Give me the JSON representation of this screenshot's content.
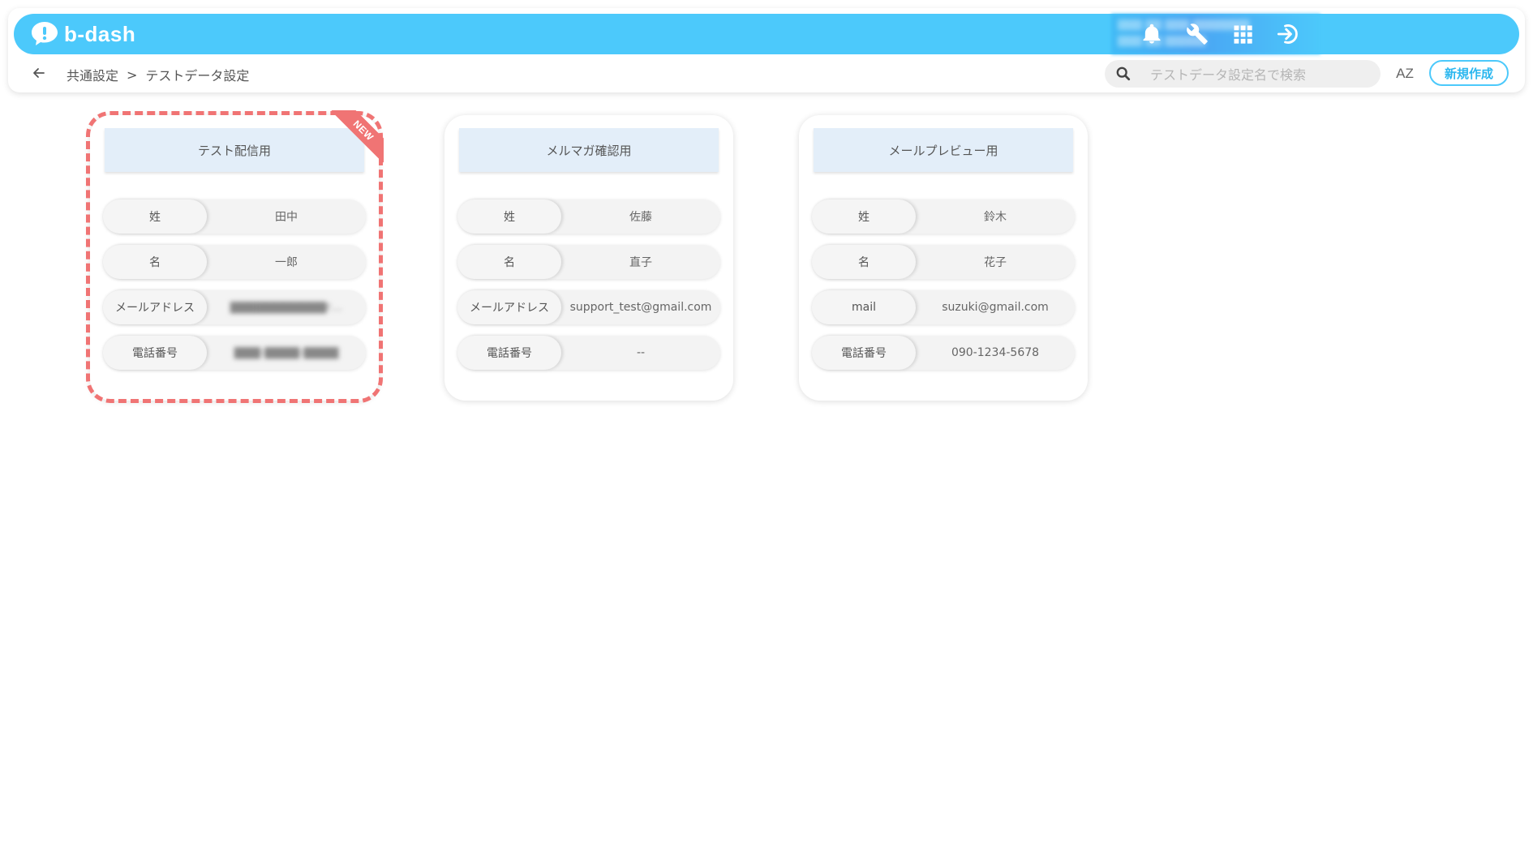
{
  "header": {
    "logo_text": "b-dash",
    "account_lines": [
      "▇▇▇ ▇▇ ▇▇▇ ▇▇▇▇▇▇▇",
      "▇▇▇ ▇▇ ▇▇▇▇▇"
    ],
    "icons": [
      "bell-icon",
      "wrench-icon",
      "grid-icon",
      "logout-icon"
    ]
  },
  "subheader": {
    "breadcrumb": [
      "共通設定",
      ">",
      "テストデータ設定"
    ],
    "search_placeholder": "テストデータ設定名で検索",
    "sort_label": "AZ",
    "new_button_label": "新規作成"
  },
  "colors": {
    "brand": "#4cc9fb",
    "new_highlight": "#f07474",
    "card_title_bg": "#e3eef9"
  },
  "cards": [
    {
      "title": "テスト配信用",
      "badge": "NEW",
      "fields": [
        {
          "label": "姓",
          "value": "田中"
        },
        {
          "label": "名",
          "value": "一郎"
        },
        {
          "label": "メールアドレス",
          "value": "▇▇▇▇▇▇▇▇▇▇▇r…"
        },
        {
          "label": "電話番号",
          "value": "▇▇▇-▇▇▇▇-▇▇▇▇"
        }
      ]
    },
    {
      "title": "メルマガ確認用",
      "fields": [
        {
          "label": "姓",
          "value": "佐藤"
        },
        {
          "label": "名",
          "value": "直子"
        },
        {
          "label": "メールアドレス",
          "value": "support_test@gmail.com"
        },
        {
          "label": "電話番号",
          "value": "--"
        }
      ]
    },
    {
      "title": "メールプレビュー用",
      "fields": [
        {
          "label": "姓",
          "value": "鈴木"
        },
        {
          "label": "名",
          "value": "花子"
        },
        {
          "label": "mail",
          "value": "suzuki@gmail.com"
        },
        {
          "label": "電話番号",
          "value": "090-1234-5678"
        }
      ]
    }
  ]
}
